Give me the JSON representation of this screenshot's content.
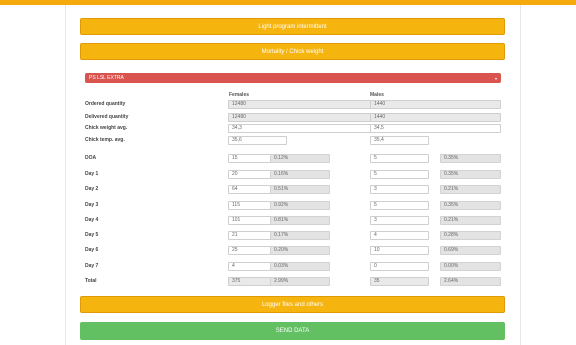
{
  "sections": {
    "light_program": "Light program intermittent",
    "mortality": "Mortality / Chick weight",
    "logger": "Logger files and others",
    "send": "SEND DATA"
  },
  "breed_select": {
    "value": "PS LSL EXTRA"
  },
  "columns": {
    "females": "Females",
    "males": "Males"
  },
  "summary_rows": [
    {
      "label": "Ordered quantity",
      "females": "12480",
      "males": "1440"
    },
    {
      "label": "Delivered quantity",
      "females": "12480",
      "males": "1440"
    },
    {
      "label": "Chick weight avg.",
      "females": "34,3",
      "males": "34,5"
    },
    {
      "label": "Chick temp. avg.",
      "females": "35,6",
      "males": "35,4"
    }
  ],
  "mortality_rows": [
    {
      "label": "DOA",
      "f": "15",
      "fp": "0.12%",
      "m": "5",
      "mp": "0.35%"
    },
    {
      "label": "Day 1",
      "f": "20",
      "fp": "0.16%",
      "m": "5",
      "mp": "0.35%"
    },
    {
      "label": "Day 2",
      "f": "64",
      "fp": "0.51%",
      "m": "3",
      "mp": "0.21%"
    },
    {
      "label": "Day 3",
      "f": "115",
      "fp": "0.92%",
      "m": "5",
      "mp": "0.35%"
    },
    {
      "label": "Day 4",
      "f": "101",
      "fp": "0.81%",
      "m": "3",
      "mp": "0.21%"
    },
    {
      "label": "Day 5",
      "f": "21",
      "fp": "0.17%",
      "m": "4",
      "mp": "0.28%"
    },
    {
      "label": "Day 6",
      "f": "25",
      "fp": "0.20%",
      "m": "10",
      "mp": "0.69%"
    },
    {
      "label": "Day 7",
      "f": "4",
      "fp": "0.03%",
      "m": "0",
      "mp": "0.00%"
    },
    {
      "label": "Total",
      "f": "375",
      "fp": "2.99%",
      "m": "35",
      "mp": "2.64%"
    }
  ],
  "colors": {
    "orange": "#f6b40e",
    "red": "#d9534f",
    "green": "#62c063"
  },
  "icons": {
    "select_caret": "chevron-down-icon"
  }
}
